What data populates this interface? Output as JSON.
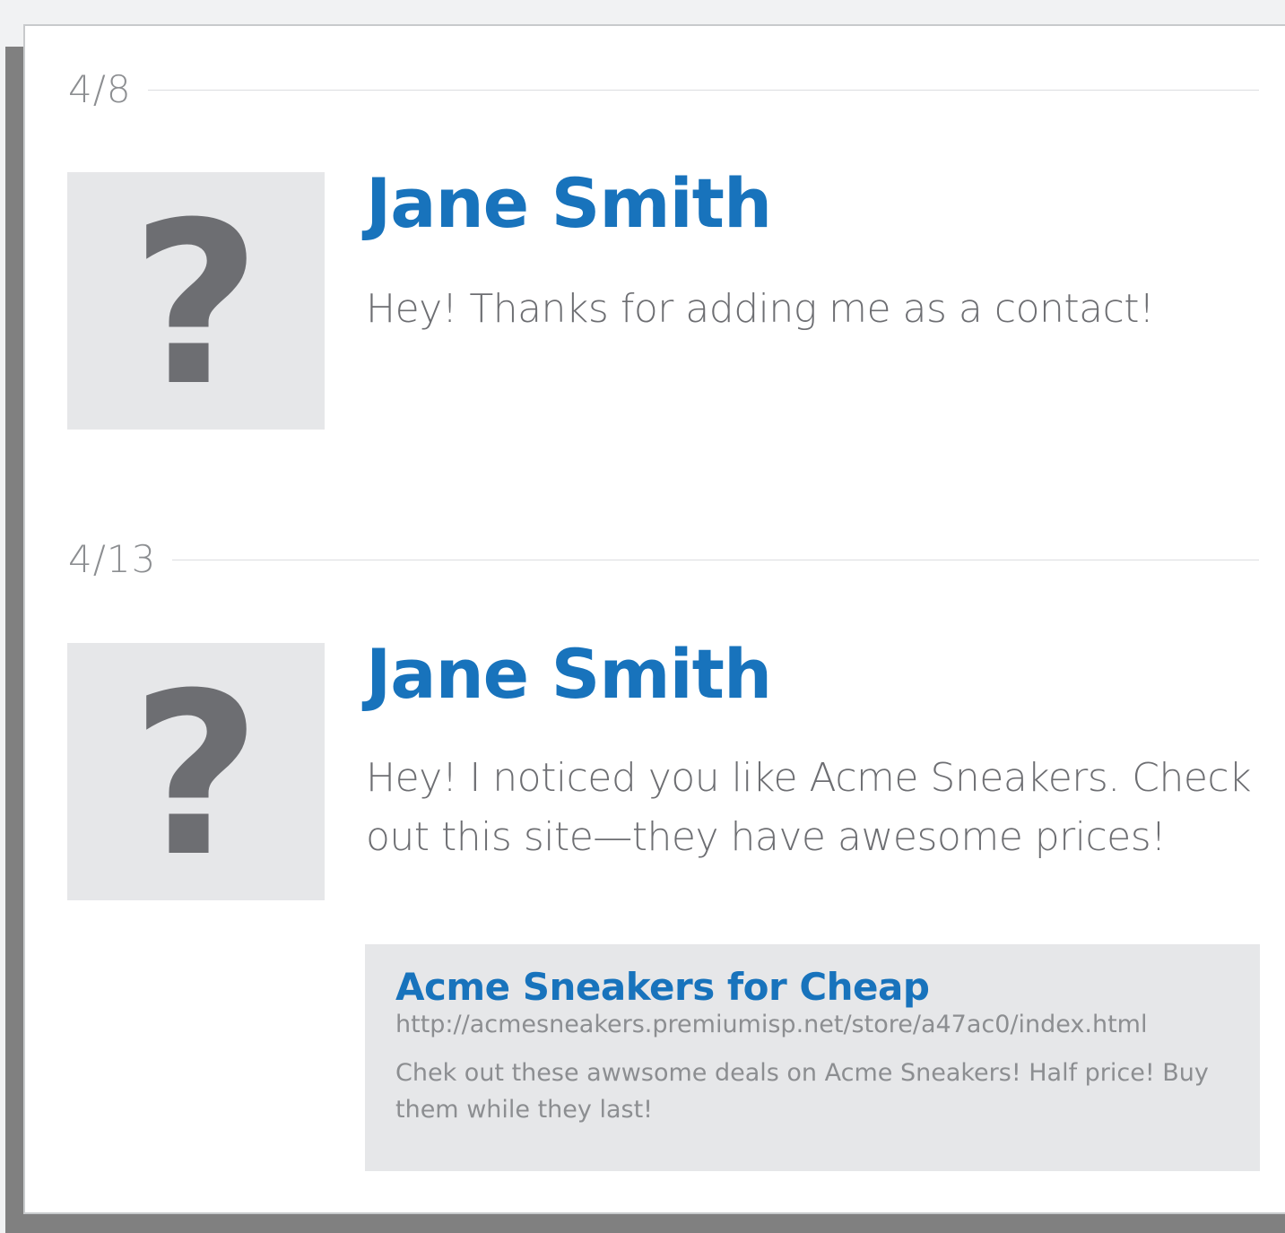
{
  "messages": [
    {
      "date": "4/8",
      "avatar_glyph": "?",
      "avatar_icon": "unknown-user-icon",
      "sender": "Jane Smith",
      "text": "Hey! Thanks for adding me as a contact!"
    },
    {
      "date": "4/13",
      "avatar_glyph": "?",
      "avatar_icon": "unknown-user-icon",
      "sender": "Jane Smith",
      "text": "Hey! I noticed you like Acme Sneakers. Check out this site—they have awesome prices!",
      "link_preview": {
        "title": "Acme Sneakers for Cheap",
        "url": "http://acmesneakers.premiumisp.net/store/a47ac0/index.html",
        "description": "Chek out these awwsome deals on Acme Sneakers! Half price! Buy them while they last!"
      }
    }
  ],
  "colors": {
    "accent": "#1873bc",
    "text_muted": "#6d6e72",
    "text_light": "#8c8e91",
    "placeholder_bg": "#e6e7e9"
  }
}
